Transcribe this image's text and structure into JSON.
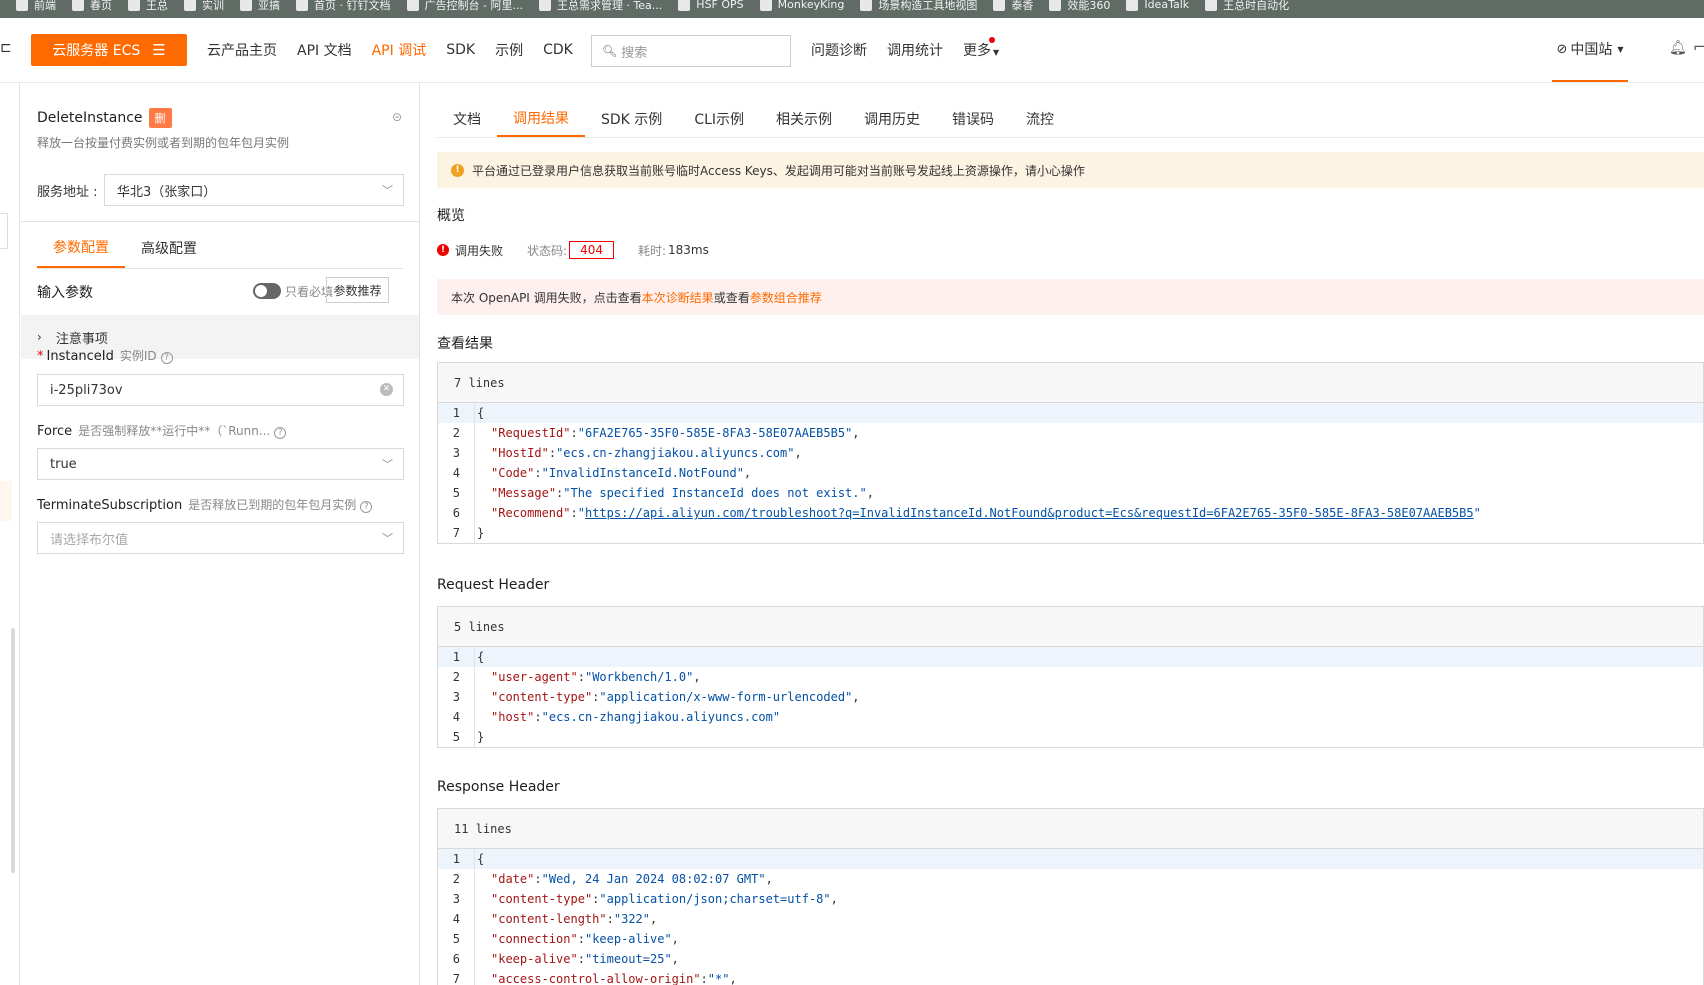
{
  "bookmarks": [
    "前端",
    "春页",
    "王总",
    "实训",
    "亚搞",
    "首页 · 钉钉文档",
    "广告控制台 - 阿里...",
    "王总需求管理 · Tea...",
    "HSF OPS",
    "MonkeyKing",
    "场景构造工具地视图",
    "泰香",
    "效能360",
    "IdeaTalk",
    "王总时自动化"
  ],
  "nav": {
    "product": "云服务器 ECS",
    "links": [
      "云产品主页",
      "API 文档",
      "API 调试",
      "SDK",
      "示例",
      "CDK"
    ],
    "active_index": 2,
    "search_placeholder": "搜索",
    "right_links": [
      "问题诊断",
      "调用统计",
      "更多"
    ],
    "region": "中国站"
  },
  "left": {
    "api_name": "DeleteInstance",
    "del_tag": "删",
    "description": "释放一台按量付费实例或者到期的包年包月实例",
    "service_label": "服务地址 :",
    "service_value": "华北3（张家口）",
    "tabs": [
      "参数配置",
      "高级配置"
    ],
    "input_params": "输入参数",
    "only_required": "只看必填",
    "recommend_btn": "参数推荐",
    "notice": "注意事项",
    "params": [
      {
        "name": "InstanceId",
        "desc": "实例ID",
        "required": true,
        "value": "i-25pli73ov"
      },
      {
        "name": "Force",
        "desc": "是否强制释放**运行中**（`Runn...",
        "value": "true"
      },
      {
        "name": "TerminateSubscription",
        "desc": "是否释放已到期的包年包月实例",
        "placeholder": "请选择布尔值"
      }
    ]
  },
  "right": {
    "tabs": [
      "文档",
      "调用结果",
      "SDK 示例",
      "CLI示例",
      "相关示例",
      "调用历史",
      "错误码",
      "流控"
    ],
    "active_tab": 1,
    "warning": "平台通过已登录用户信息获取当前账号临时Access Keys、发起调用可能对当前账号发起线上资源操作，请小心操作",
    "overview": "概览",
    "status_fail": "调用失败",
    "status_code_label": "状态码:",
    "status_code": "404",
    "time_label": "耗时:",
    "time_value": "183ms",
    "fail_msg_1": "本次 OpenAPI 调用失败，点击查看",
    "fail_link_1": "本次诊断结果",
    "fail_msg_2": "或查看",
    "fail_link_2": "参数组合推荐",
    "result_title": "查看结果",
    "result_lines": "7 lines",
    "req_title": "Request Header",
    "req_lines": "5 lines",
    "resp_title": "Response Header",
    "resp_lines": "11 lines"
  },
  "code": {
    "result": [
      {
        "k": "RequestId",
        "v": "6FA2E765-35F0-585E-8FA3-58E07AAEB5B5"
      },
      {
        "k": "HostId",
        "v": "ecs.cn-zhangjiakou.aliyuncs.com"
      },
      {
        "k": "Code",
        "v": "InvalidInstanceId.NotFound"
      },
      {
        "k": "Message",
        "v": "The specified InstanceId does not exist."
      },
      {
        "k": "Recommend",
        "v": "https://api.aliyun.com/troubleshoot?q=InvalidInstanceId.NotFound&product=Ecs&requestId=6FA2E765-35F0-585E-8FA3-58E07AAEB5B5",
        "url": true
      }
    ],
    "request": [
      {
        "k": "user-agent",
        "v": "Workbench/1.0"
      },
      {
        "k": "content-type",
        "v": "application/x-www-form-urlencoded"
      },
      {
        "k": "host",
        "v": "ecs.cn-zhangjiakou.aliyuncs.com"
      }
    ],
    "response": [
      {
        "k": "date",
        "v": "Wed, 24 Jan 2024 08:02:07 GMT"
      },
      {
        "k": "content-type",
        "v": "application/json;charset=utf-8"
      },
      {
        "k": "content-length",
        "v": "322"
      },
      {
        "k": "connection",
        "v": "keep-alive"
      },
      {
        "k": "keep-alive",
        "v": "timeout=25"
      },
      {
        "k": "access-control-allow-origin",
        "v": "*"
      }
    ]
  }
}
